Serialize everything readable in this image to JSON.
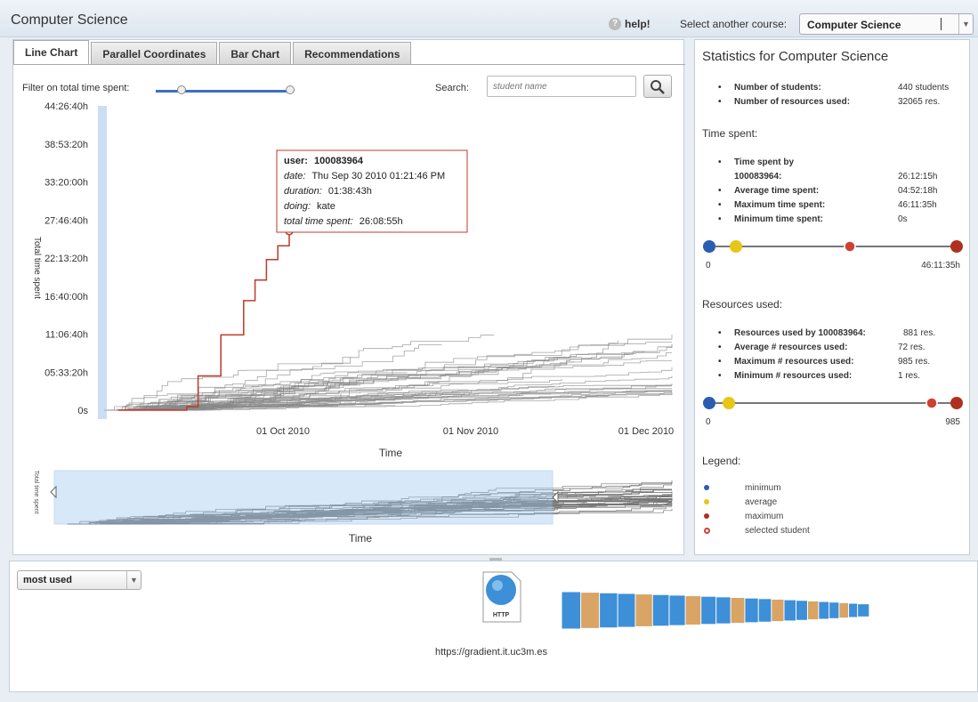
{
  "app": {
    "title": "Computer Science"
  },
  "header": {
    "help_label": "help!",
    "course_label": "Select another course:",
    "course_value": "Computer Science"
  },
  "tabs": [
    {
      "label": "Line Chart",
      "active": true
    },
    {
      "label": "Parallel Coordinates",
      "active": false
    },
    {
      "label": "Bar Chart",
      "active": false
    },
    {
      "label": "Recommendations",
      "active": false
    }
  ],
  "filter": {
    "label": "Filter on total time spent:"
  },
  "search": {
    "label": "Search:",
    "placeholder": "student name"
  },
  "tooltip": {
    "user_label": "user:",
    "user_value": "100083964",
    "date_label": "date:",
    "date_value": "Thu Sep 30 2010 01:21:46 PM",
    "duration_label": "duration:",
    "duration_value": "01:38:43h",
    "doing_label": "doing:",
    "doing_value": "kate",
    "total_label": "total time spent:",
    "total_value": "26:08:55h"
  },
  "chart_data": [
    {
      "type": "line",
      "title": "",
      "xlabel": "Time",
      "ylabel": "Total time spent",
      "y_ticks": [
        "0s",
        "05:33:20h",
        "11:06:40h",
        "16:40:00h",
        "22:13:20h",
        "27:46:40h",
        "33:20:00h",
        "38:53:20h",
        "44:26:40h"
      ],
      "x_ticks": [
        "01 Oct 2010",
        "01 Nov 2010",
        "01 Dec 2010"
      ],
      "ylim_hours": [
        0,
        44.44
      ],
      "grid": false,
      "selected_series": {
        "name": "100083964",
        "color": "#c0392b",
        "points_days_hours": [
          [
            0,
            0
          ],
          [
            12,
            0.5
          ],
          [
            14,
            5
          ],
          [
            18,
            11
          ],
          [
            22,
            16
          ],
          [
            24,
            19
          ],
          [
            26,
            22
          ],
          [
            28,
            24
          ],
          [
            30,
            26.15
          ]
        ]
      },
      "background_series_color": "#888888",
      "background_series_count": 60
    },
    {
      "type": "area",
      "xlabel": "Time",
      "ylabel": "Total time spent",
      "role": "overview"
    }
  ],
  "stats": {
    "title": "Statistics for Computer Science",
    "students_label": "Number of students:",
    "students_value": "440 students",
    "resources_label": "Number of resources used:",
    "resources_value": "32065 res.",
    "time_heading": "Time spent:",
    "ts_by_label_1": "Time spent by",
    "ts_by_label_2": "100083964:",
    "ts_by_value": "26:12:15h",
    "avg_time_label": "Average time spent:",
    "avg_time_value": "04:52:18h",
    "max_time_label": "Maximum time spent:",
    "max_time_value": "46:11:35h",
    "min_time_label": "Minimum time spent:",
    "min_time_value": "0s",
    "time_scale_min": "0",
    "time_scale_max": "46:11:35h",
    "res_heading": "Resources used:",
    "res_by_label": "Resources used by 100083964:",
    "res_by_value": "881 res.",
    "avg_res_label": "Average # resources used:",
    "avg_res_value": "72 res.",
    "max_res_label": "Maximum # resources used:",
    "max_res_value": "985 res.",
    "min_res_label": "Minimum # resources used:",
    "min_res_value": "1 res.",
    "res_scale_min": "0",
    "res_scale_max": "985",
    "legend_heading": "Legend:",
    "legend": [
      {
        "label": "minimum",
        "color": "#2a5db0"
      },
      {
        "label": "average",
        "color": "#e8c618"
      },
      {
        "label": "maximum",
        "color": "#b03020"
      },
      {
        "label": "selected student",
        "color": "#d04030"
      }
    ]
  },
  "bottom": {
    "sort_value": "most used",
    "resource_badge": "HTTP",
    "resource_url": "https://gradient.it.uc3m.es"
  }
}
